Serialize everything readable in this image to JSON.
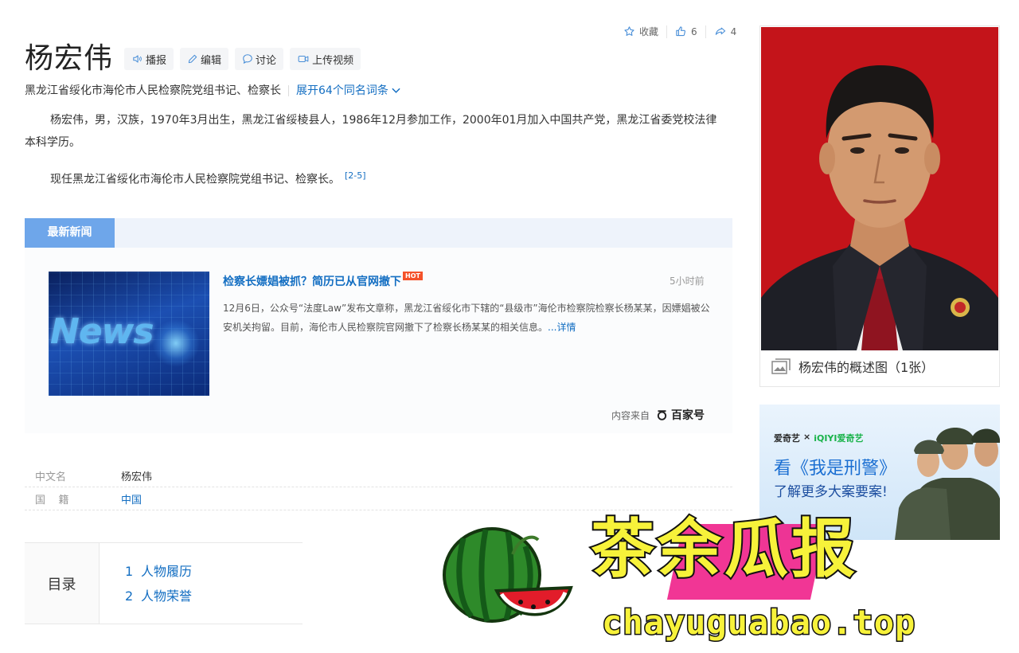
{
  "header": {
    "title": "杨宏伟",
    "buttons": {
      "play": "播报",
      "edit": "编辑",
      "discuss": "讨论",
      "upload_video": "上传视频"
    },
    "subtitle": "黑龙江省绥化市海伦市人民检察院党组书记、检察长",
    "expand_link": "展开64个同名词条",
    "actions": {
      "collect": "收藏",
      "likes": "6",
      "shares": "4"
    }
  },
  "summary": {
    "p1": "杨宏伟，男，汉族，1970年3月出生，黑龙江省绥棱县人，1986年12月参加工作，2000年01月加入中国共产党，黑龙江省委党校法律本科学历。",
    "p2": "现任黑龙江省绥化市海伦市人民检察院党组书记、检察长。",
    "p2_cite": "[2-5]"
  },
  "news": {
    "tab": "最新新闻",
    "thumb_word": "News",
    "title": "检察长嫖娼被抓？简历已从官网撤下",
    "hot": "HOT",
    "time": "5小时前",
    "body": "12月6日，公众号“法度Law”发布文章称，黑龙江省绥化市下辖的“县级市”海伦市检察院检察长杨某某，因嫖娼被公安机关拘留。目前，海伦市人民检察院官网撤下了检察长杨某某的相关信息。",
    "more": "...详情",
    "source_label": "内容来自",
    "source_brand": "百家号"
  },
  "basic_info": [
    {
      "key": "中文名",
      "value": "杨宏伟"
    },
    {
      "key": "国    籍",
      "value": "中国"
    }
  ],
  "toc": {
    "label": "目录",
    "items": [
      {
        "num": "1",
        "text": "人物履历"
      },
      {
        "num": "2",
        "text": "人物荣誉"
      }
    ]
  },
  "sidebar": {
    "portrait_caption": "杨宏伟的概述图（1张）",
    "ad": {
      "brand_left": "爱奇艺",
      "brand_right": "iQIYI爱奇艺",
      "line1": "看《我是刑警》",
      "line2": "了解更多大案要案!"
    }
  },
  "watermark": {
    "text": "茶余瓜报",
    "url": "chayuguabao.top"
  },
  "colors": {
    "link": "#136ec2",
    "news_tab": "#6ea6ea",
    "portrait_bg": "#c4141a",
    "watermark": "#f7f23a"
  },
  "icons": [
    "star-icon",
    "thumb-up-icon",
    "share-icon",
    "speaker-icon",
    "pencil-icon",
    "chat-bubble-icon",
    "video-camera-icon",
    "chevron-down-icon",
    "gallery-icon",
    "baijiahao-logo-icon",
    "watermelon-icon"
  ]
}
